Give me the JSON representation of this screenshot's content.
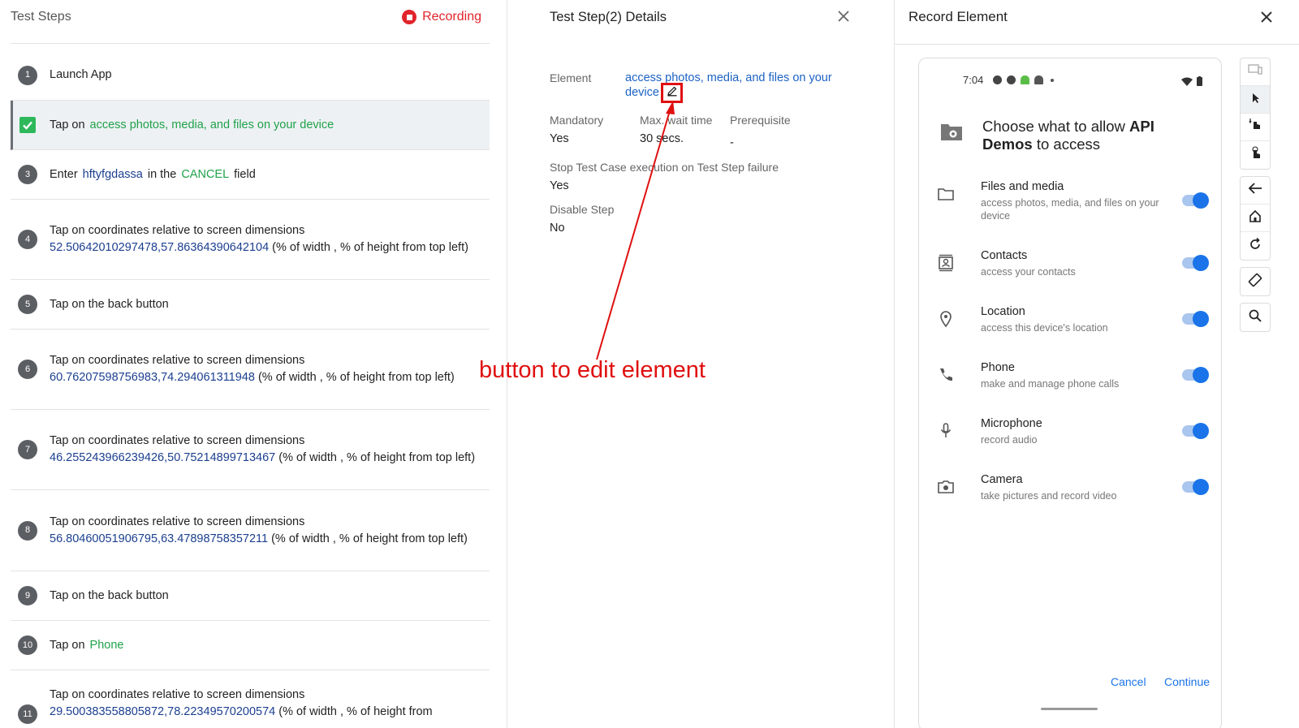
{
  "left": {
    "title": "Test Steps",
    "recording_label": "Recording",
    "steps": [
      {
        "num": "1",
        "text": "Launch App"
      },
      {
        "num": "",
        "prefix": "Tap on",
        "target": "access photos, media, and files on your device"
      },
      {
        "num": "3",
        "p1": "Enter",
        "v1": "hftyfgdassa",
        "p2": "in the",
        "v2": "CANCEL",
        "p3": "field"
      },
      {
        "num": "4",
        "line1": "Tap on coordinates relative to screen dimensions",
        "coords": "52.50642010297478,57.86364390642104",
        "suffix": " (% of width , % of height from top left)"
      },
      {
        "num": "5",
        "text": "Tap on the back button"
      },
      {
        "num": "6",
        "line1": "Tap on coordinates relative to screen dimensions",
        "coords": "60.76207598756983,74.294061311948",
        "suffix": " (% of width , % of height from top left)"
      },
      {
        "num": "7",
        "line1": "Tap on coordinates relative to screen dimensions",
        "coords": "46.255243966239426,50.75214899713467",
        "suffix": " (% of width , % of height from top left)"
      },
      {
        "num": "8",
        "line1": "Tap on coordinates relative to screen dimensions",
        "coords": "56.80460051906795,63.47898758357211",
        "suffix": " (% of width , % of height from top left)"
      },
      {
        "num": "9",
        "text": "Tap on the back button"
      },
      {
        "num": "10",
        "prefix": "Tap on",
        "target": "Phone"
      },
      {
        "num": "11",
        "line1": "Tap on coordinates relative to screen dimensions",
        "coords": "29.500383558805872,78.22349570200574",
        "suffix": " (% of width , % of height from"
      }
    ]
  },
  "middle": {
    "title": "Test Step(2) Details",
    "element_label": "Element",
    "element_value": "access photos, media, and files on your device",
    "mandatory_label": "Mandatory",
    "mandatory_value": "Yes",
    "wait_label": "Max. wait time",
    "wait_value": "30 secs.",
    "prereq_label": "Prerequisite",
    "prereq_value": "-",
    "stop_label": "Stop Test Case execution on Test Step failure",
    "stop_value": "Yes",
    "disable_label": "Disable Step",
    "disable_value": "No"
  },
  "annotation": {
    "text": "button to edit element",
    "color": "#e01010"
  },
  "right": {
    "title": "Record Element",
    "device": {
      "time": "7:04",
      "heading_pre": "Choose what to allow ",
      "heading_bold": "API Demos",
      "heading_post": " to access",
      "permissions": [
        {
          "name": "Files and media",
          "desc": "access photos, media, and files on your device",
          "icon": "folder-icon",
          "enabled": true
        },
        {
          "name": "Contacts",
          "desc": "access your contacts",
          "icon": "contacts-icon",
          "enabled": true
        },
        {
          "name": "Location",
          "desc": "access this device's location",
          "icon": "location-pin-icon",
          "enabled": true
        },
        {
          "name": "Phone",
          "desc": "make and manage phone calls",
          "icon": "phone-icon",
          "enabled": true
        },
        {
          "name": "Microphone",
          "desc": "record audio",
          "icon": "microphone-icon",
          "enabled": true
        },
        {
          "name": "Camera",
          "desc": "take pictures and record video",
          "icon": "camera-icon",
          "enabled": true
        }
      ],
      "cancel_label": "Cancel",
      "continue_label": "Continue"
    }
  },
  "colors": {
    "accent_green": "#1fa24a",
    "coord_blue": "#1b3f8f",
    "link_blue": "#1b62c4",
    "recording_red": "#e0242b",
    "android_blue": "#1a73e8"
  }
}
